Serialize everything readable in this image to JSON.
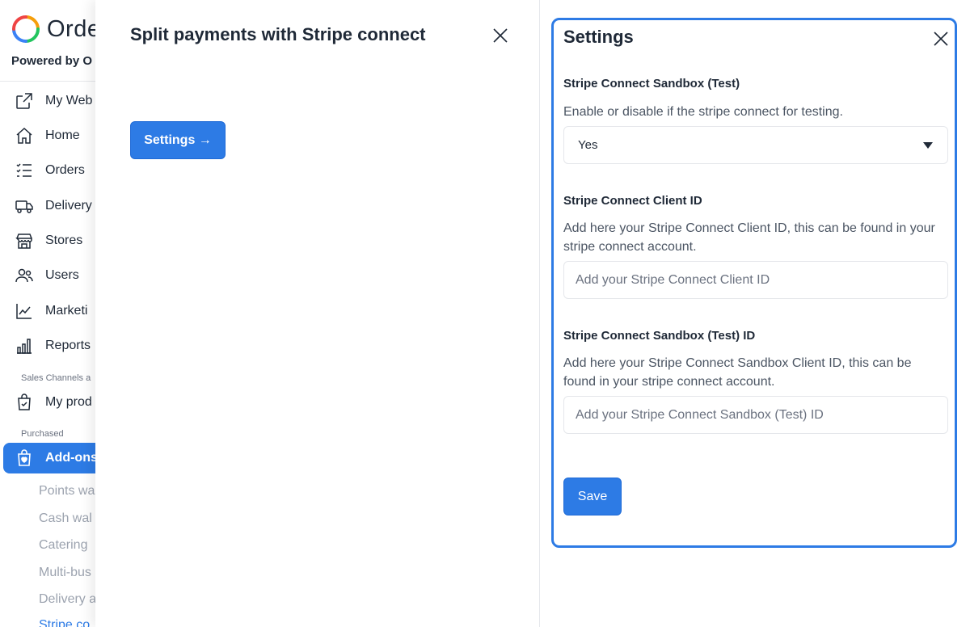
{
  "brand": {
    "name": "Orde",
    "powered_by": "Powered by O"
  },
  "sidebar": {
    "items": [
      {
        "label": "My Web",
        "icon": "external-link-icon"
      },
      {
        "label": "Home",
        "icon": "home-icon"
      },
      {
        "label": "Orders",
        "icon": "list-icon"
      },
      {
        "label": "Delivery",
        "icon": "truck-icon"
      },
      {
        "label": "Stores",
        "icon": "store-icon"
      },
      {
        "label": "Users",
        "icon": "users-icon"
      },
      {
        "label": "Marketi",
        "icon": "chart-line-icon"
      },
      {
        "label": "Reports",
        "icon": "bar-chart-icon"
      }
    ],
    "section_sales": "Sales Channels a",
    "my_products": {
      "label": "My prod",
      "icon": "bag-check-icon"
    },
    "section_purchased": "Purchased",
    "addons": {
      "label": "Add-ons",
      "icon": "bag-heart-icon"
    },
    "sub_items": [
      "Points wa",
      "Cash wal",
      "Catering",
      "Multi-bus",
      "Delivery a",
      "Stripe co"
    ]
  },
  "drawer": {
    "title": "Split payments with Stripe connect",
    "settings_button": "Settings →"
  },
  "settings_panel": {
    "title": "Settings",
    "sandbox": {
      "label": "Stripe Connect Sandbox (Test)",
      "help": "Enable or disable if the stripe connect for testing.",
      "value": "Yes"
    },
    "client_id": {
      "label": "Stripe Connect Client ID",
      "help": "Add here your Stripe Connect Client ID, this can be found in your stripe connect account.",
      "placeholder": "Add your Stripe Connect Client ID",
      "value": ""
    },
    "sandbox_id": {
      "label": "Stripe Connect Sandbox (Test) ID",
      "help": "Add here your Stripe Connect Sandbox Client ID, this can be found in your stripe connect account.",
      "placeholder": "Add your Stripe Connect Sandbox (Test) ID",
      "value": ""
    },
    "save_button": "Save"
  },
  "colors": {
    "accent": "#2d7be5",
    "text": "#1f2937",
    "muted": "#9ca3af"
  }
}
